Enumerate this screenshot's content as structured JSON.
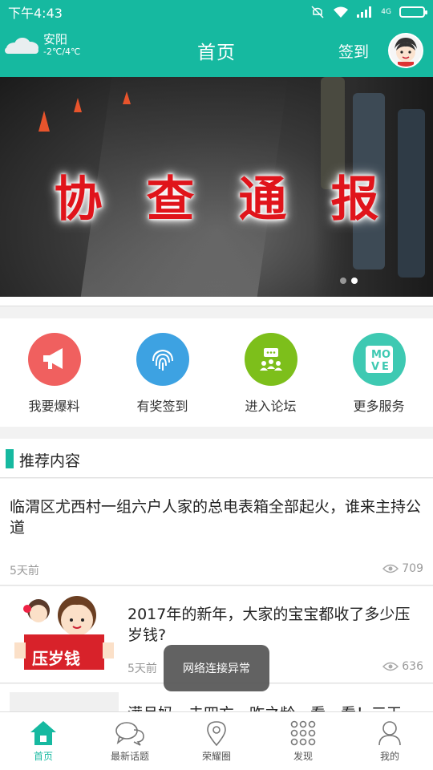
{
  "status_bar": {
    "time": "下午4:43",
    "network": "4G",
    "battery_icon": "battery-icon"
  },
  "header": {
    "city": "安阳",
    "temp": "-2℃/4℃",
    "title": "首页",
    "signin_label": "签到",
    "accent": "#16b9a0"
  },
  "banner": {
    "chars": [
      "协",
      "查",
      "通",
      "报"
    ],
    "active_dot": 2,
    "dot_count": 2
  },
  "services": [
    {
      "label": "我要爆料",
      "icon": "megaphone-icon",
      "color": "#f0605f"
    },
    {
      "label": "有奖签到",
      "icon": "fingerprint-icon",
      "color": "#3da2e2"
    },
    {
      "label": "进入论坛",
      "icon": "forum-icon",
      "color": "#7dbf1b"
    },
    {
      "label": "更多服务",
      "icon": "move-icon",
      "color": "#3ec9b2"
    }
  ],
  "recommend": {
    "title": "推荐内容"
  },
  "articles": [
    {
      "title": "临渭区尤西村一组六户人家的总电表箱全部起火，谁来主持公道",
      "time": "5天前",
      "views": "709"
    },
    {
      "title": "2017年的新年，大家的宝宝都收了多少压岁钱?",
      "time": "5天前",
      "views": "636",
      "thumb_text": "压岁钱"
    },
    {
      "title": "满月妈，未四方，昨之龄，看，看！三天"
    }
  ],
  "toast": "网络连接异常",
  "bottom_nav": [
    {
      "label": "首页",
      "icon": "home-icon",
      "active": true
    },
    {
      "label": "最新话题",
      "icon": "chat-icon"
    },
    {
      "label": "荣耀圈",
      "icon": "location-pin-icon"
    },
    {
      "label": "发现",
      "icon": "grid-dots-icon"
    },
    {
      "label": "我的",
      "icon": "person-icon"
    }
  ]
}
